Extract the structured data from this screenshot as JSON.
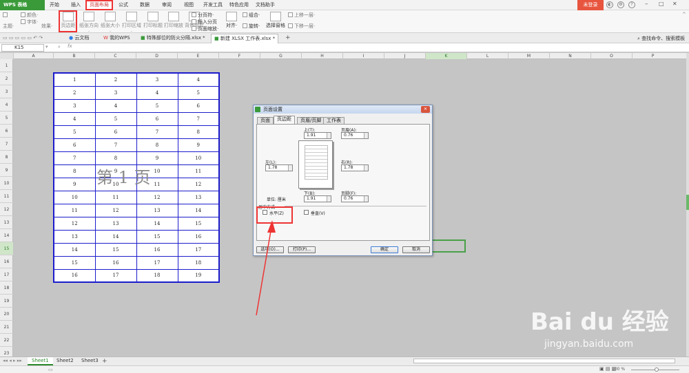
{
  "app": {
    "logo": "WPS 表格",
    "login": "未登录"
  },
  "menu": [
    "开始",
    "插入",
    "页面布局",
    "公式",
    "数据",
    "审阅",
    "视图",
    "开发工具",
    "特色应用",
    "文档助手"
  ],
  "ribbon": {
    "theme": "主题·",
    "colors": "颜色·",
    "font": "字体·",
    "effects": "效果·",
    "margins": "页边距",
    "orientation": "纸张方向·",
    "size": "纸张大小·",
    "print_area": "打印区域·",
    "print_titles": "打印标题",
    "print_scale": "打印缩放",
    "background": "背景图片",
    "page_break": "分页符·",
    "insert": "插入分页符·",
    "page_zoom": "页面缩放·",
    "align": "对齐·",
    "group": "组合·",
    "rotate": "旋转·",
    "select_pane": "选择窗格",
    "bring_forward": "上移一层·",
    "send_backward": "下移一层·"
  },
  "doctabs": [
    "云文档",
    "我的WPS",
    "特殊部位的防火分隔.xlsx *",
    "新建 XLSX 工作表.xlsx *"
  ],
  "search_command": "查找命令、搜索模板",
  "formula": {
    "cell": "K15",
    "fx": "fx"
  },
  "columns": [
    "A",
    "B",
    "C",
    "D",
    "E",
    "F",
    "G",
    "H",
    "I",
    "J",
    "K",
    "L",
    "M",
    "N",
    "O",
    "P"
  ],
  "rows": [
    "1",
    "2",
    "3",
    "4",
    "5",
    "6",
    "7",
    "8",
    "9",
    "10",
    "11",
    "12",
    "13",
    "14",
    "15",
    "16",
    "17",
    "18",
    "19",
    "20",
    "21",
    "22",
    "23"
  ],
  "table": [
    [
      "1",
      "2",
      "3",
      "4"
    ],
    [
      "2",
      "3",
      "4",
      "5"
    ],
    [
      "3",
      "4",
      "5",
      "6"
    ],
    [
      "4",
      "5",
      "6",
      "7"
    ],
    [
      "5",
      "6",
      "7",
      "8"
    ],
    [
      "6",
      "7",
      "8",
      "9"
    ],
    [
      "7",
      "8",
      "9",
      "10"
    ],
    [
      "8",
      "9",
      "10",
      "11"
    ],
    [
      "9",
      "10",
      "11",
      "12"
    ],
    [
      "10",
      "11",
      "12",
      "13"
    ],
    [
      "11",
      "12",
      "13",
      "14"
    ],
    [
      "12",
      "13",
      "14",
      "15"
    ],
    [
      "13",
      "14",
      "15",
      "16"
    ],
    [
      "14",
      "15",
      "16",
      "17"
    ],
    [
      "15",
      "16",
      "17",
      "18"
    ],
    [
      "16",
      "17",
      "18",
      "19"
    ]
  ],
  "watermark": "第 1 页",
  "dialog": {
    "title": "页面设置",
    "tabs": [
      "页面",
      "页边距",
      "页眉/页脚",
      "工作表"
    ],
    "top_label": "上(T):",
    "top_value": "1.91",
    "header_label": "页眉(A):",
    "header_value": "0.76",
    "left_label": "左(L):",
    "left_value": "1.78",
    "right_label": "右(R):",
    "right_value": "1.78",
    "bottom_label": "下(B):",
    "bottom_value": "1.91",
    "footer_label": "页脚(F):",
    "footer_value": "0.76",
    "unit": "单位: 厘米",
    "center_group": "居中方式",
    "horizontal": "水平(Z)",
    "vertical": "垂直(V)",
    "options": "选项(O)...",
    "print": "打印(P)...",
    "ok": "确定",
    "cancel": "取消"
  },
  "sheets": [
    "Sheet1",
    "Sheet2",
    "Sheet3"
  ],
  "zoom": "100 %",
  "watermark_brand": {
    "logo": "Bai du 经验",
    "url": "jingyan.baidu.com"
  }
}
